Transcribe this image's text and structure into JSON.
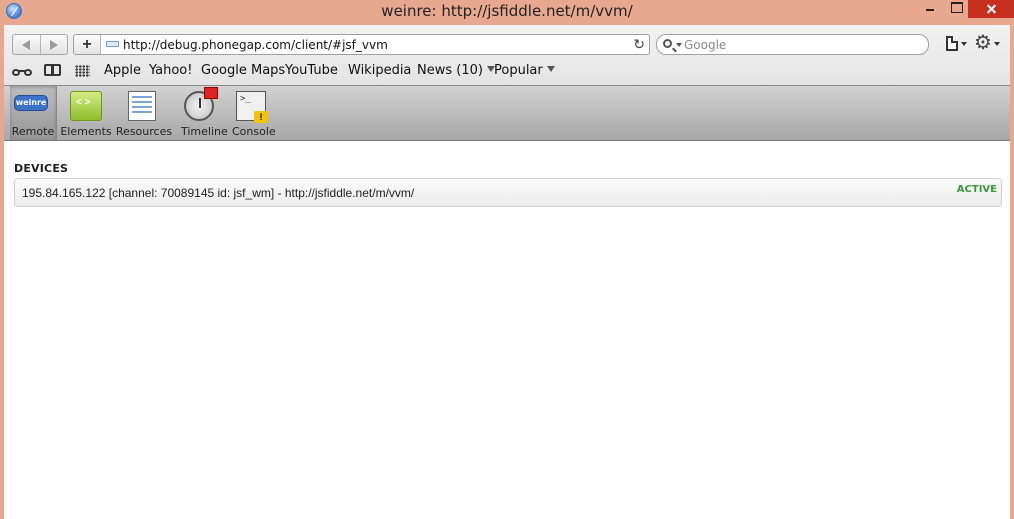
{
  "window": {
    "title": "weinre: http://jsfiddle.net/m/vvm/"
  },
  "toolbar": {
    "add_label": "+",
    "url": "http://debug.phonegap.com/client/#jsf_vvm",
    "search_placeholder": "Google"
  },
  "bookmarks": [
    {
      "label": "Apple"
    },
    {
      "label": "Yahoo!"
    },
    {
      "label": "Google Maps"
    },
    {
      "label": "YouTube"
    },
    {
      "label": "Wikipedia"
    },
    {
      "label": "News (10)",
      "dropdown": true
    },
    {
      "label": "Popular",
      "dropdown": true
    }
  ],
  "inspector_tabs": [
    {
      "label": "Remote",
      "icon": "weinre-icon",
      "icon_text": "weinre",
      "active": true
    },
    {
      "label": "Elements",
      "icon": "elements-icon"
    },
    {
      "label": "Resources",
      "icon": "resources-icon"
    },
    {
      "label": "Timeline",
      "icon": "timeline-icon"
    },
    {
      "label": "Console",
      "icon": "console-icon"
    }
  ],
  "devices": {
    "title": "DEVICES",
    "items": [
      {
        "text": "195.84.165.122 [channel: 70089145 id: jsf_wm] - http://jsfiddle.net/m/vvm/",
        "status": "ACTIVE"
      }
    ]
  },
  "colors": {
    "title_bar": "#e8a890",
    "close_button": "#c7301f",
    "status_active": "#3a9a3a"
  }
}
